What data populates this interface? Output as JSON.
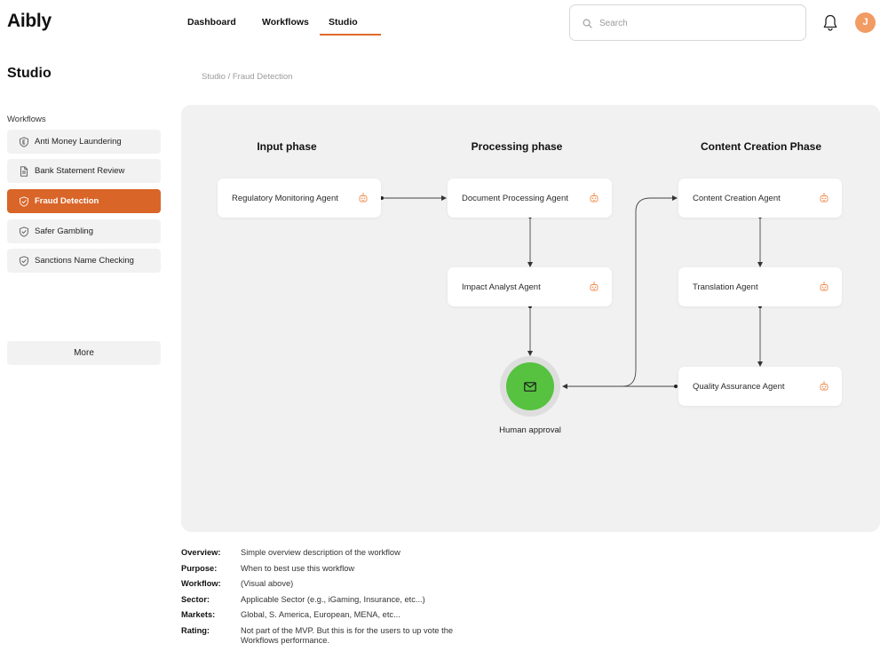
{
  "app": {
    "logo": "Aibly"
  },
  "nav": {
    "tabs": [
      {
        "label": "Dashboard"
      },
      {
        "label": "Workflows"
      },
      {
        "label": "Studio",
        "active": true
      }
    ]
  },
  "search": {
    "placeholder": "Search",
    "icon": "search-icon"
  },
  "notifications": {
    "icon": "bell-icon"
  },
  "user": {
    "avatar_initial": "J",
    "avatar_color": "#f29b63"
  },
  "sidebar": {
    "title": "Studio",
    "section_label": "Workflows",
    "items": [
      {
        "label": "Anti Money Laundering",
        "icon": "shield-e-icon"
      },
      {
        "label": "Bank Statement Review",
        "icon": "document-icon"
      },
      {
        "label": "Fraud Detection",
        "icon": "shield-check-icon",
        "active": true
      },
      {
        "label": "Safer Gambling",
        "icon": "shield-check-icon"
      },
      {
        "label": "Sanctions Name Checking",
        "icon": "shield-check-icon"
      }
    ],
    "more_label": "More"
  },
  "breadcrumb": "Studio / Fraud Detection",
  "workflow": {
    "phases": [
      {
        "title": "Input phase"
      },
      {
        "title": "Processing phase"
      },
      {
        "title": "Content Creation Phase"
      }
    ],
    "nodes": {
      "regulatory": "Regulatory Monitoring Agent",
      "document": "Document Processing Agent",
      "impact": "Impact Analyst Agent",
      "content": "Content Creation Agent",
      "translation": "Translation Agent",
      "qa": "Quality Assurance Agent"
    },
    "agent_icon": "robot-icon",
    "approval": {
      "label": "Human approval",
      "icon": "mail-icon",
      "color": "#56c240"
    }
  },
  "details": [
    {
      "key": "Overview:",
      "value": "Simple overview description of the workflow"
    },
    {
      "key": "Purpose:",
      "value": "When to best use this workflow"
    },
    {
      "key": "Workflow:",
      "value": "(Visual above)"
    },
    {
      "key": "Sector:",
      "value": "Applicable Sector (e.g., iGaming, Insurance, etc...)"
    },
    {
      "key": "Markets:",
      "value": "Global, S. America, European, MENA, etc..."
    },
    {
      "key": "Rating:",
      "value": "Not part of the MVP. But this is for the users to up vote the Workflows performance."
    }
  ],
  "colors": {
    "accent": "#d96528",
    "canvas_bg": "#f1f1f2"
  }
}
